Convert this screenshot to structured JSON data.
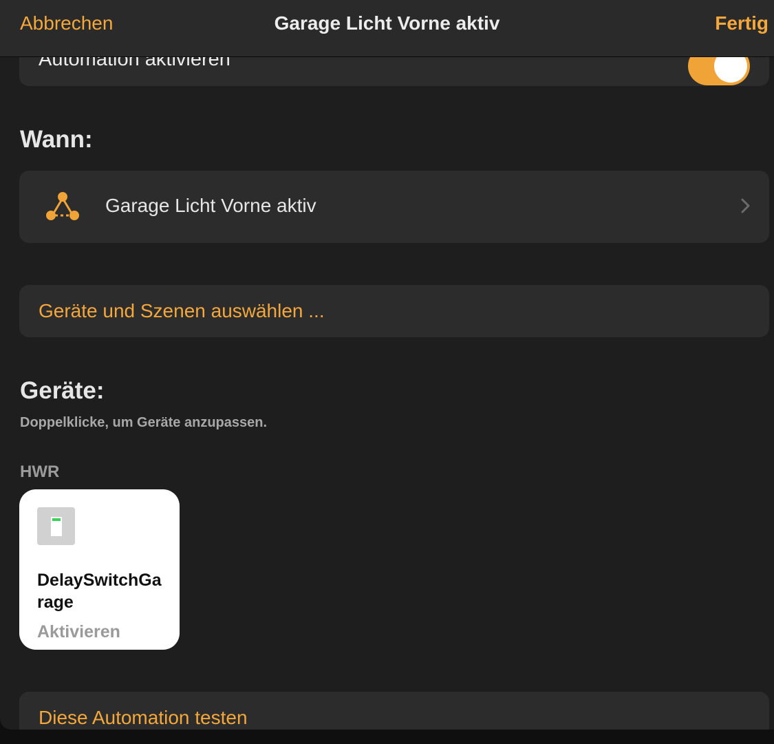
{
  "navbar": {
    "cancel_label": "Abbrechen",
    "title": "Garage Licht Vorne aktiv",
    "done_label": "Fertig"
  },
  "activation": {
    "label": "Automation aktivieren",
    "enabled": true
  },
  "when": {
    "heading": "Wann:",
    "trigger_label": "Garage Licht Vorne aktiv",
    "trigger_icon": "automation-triangle-icon"
  },
  "select_link": "Geräte und Szenen auswählen ...",
  "devices": {
    "heading": "Geräte:",
    "hint": "Doppelklicke, um Geräte anzupassen.",
    "room": "HWR",
    "tiles": [
      {
        "name": "DelaySwitchGarage",
        "state": "Aktivieren",
        "icon": "switch-icon"
      }
    ]
  },
  "test_link": "Diese Automation testen",
  "colors": {
    "accent": "#f4a73a",
    "background": "#1e1e1e",
    "card": "#2c2c2c",
    "tile": "#ffffff"
  }
}
